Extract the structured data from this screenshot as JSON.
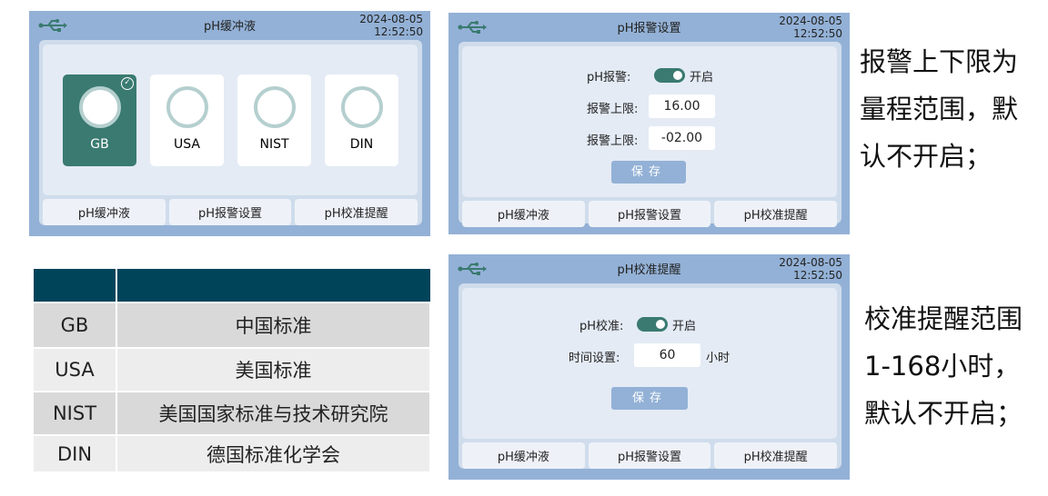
{
  "screens": [
    {
      "title": "pH缓冲液",
      "date": "2024-08-05",
      "time": "12:52:50",
      "standards": [
        {
          "label": "GB",
          "selected": true
        },
        {
          "label": "USA",
          "selected": false
        },
        {
          "label": "NIST",
          "selected": false
        },
        {
          "label": "DIN",
          "selected": false
        }
      ]
    },
    {
      "title": "pH报警设置",
      "date": "2024-08-05",
      "time": "12:52:50",
      "toggle_label": "pH报警:",
      "toggle_state": "开启",
      "toggle_on": true,
      "upper_label": "报警上限:",
      "upper_value": "16.00",
      "lower_label": "报警上限:",
      "lower_value": "-02.00",
      "save": "保存"
    },
    {
      "title": "pH校准提醒",
      "date": "2024-08-05",
      "time": "12:52:50",
      "toggle_label": "pH校准:",
      "toggle_state": "开启",
      "toggle_on": true,
      "time_label": "时间设置:",
      "time_value": "60",
      "time_unit": "小时",
      "save": "保存"
    }
  ],
  "tabs": [
    "pH缓冲液",
    "pH报警设置",
    "pH校准提醒"
  ],
  "table": {
    "rows": [
      [
        "GB",
        "中国标准"
      ],
      [
        "USA",
        "美国标准"
      ],
      [
        "NIST",
        "美国国家标准与技术研究院"
      ],
      [
        "DIN",
        "德国标准化学会"
      ]
    ]
  },
  "notes": {
    "alarm": "报警上下限为量程范围，默认不开启；",
    "calib": "校准提醒范围1-168小时，默认不开启；"
  },
  "colors": {
    "header": "#93b1d6",
    "accent": "#3a7a70",
    "table_header": "#00445a"
  }
}
